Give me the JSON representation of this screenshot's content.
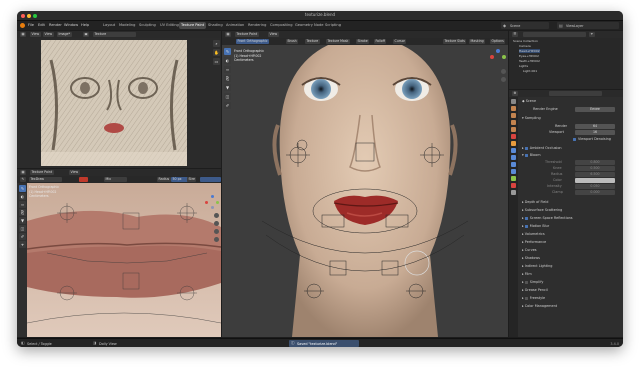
{
  "window": {
    "title": "texturize.blend"
  },
  "menu": [
    "File",
    "Edit",
    "Render",
    "Window",
    "Help"
  ],
  "workspaces": [
    {
      "label": "Layout",
      "active": false
    },
    {
      "label": "Modeling",
      "active": false
    },
    {
      "label": "Sculpting",
      "active": false
    },
    {
      "label": "UV Editing",
      "active": false
    },
    {
      "label": "Texture Paint",
      "active": true
    },
    {
      "label": "Shading",
      "active": false
    },
    {
      "label": "Animation",
      "active": false
    },
    {
      "label": "Rendering",
      "active": false
    },
    {
      "label": "Compositing",
      "active": false
    },
    {
      "label": "Geometry Node",
      "active": false
    },
    {
      "label": "Scripting",
      "active": false
    }
  ],
  "scene": {
    "label": "Scene",
    "view_layer": "ViewLayer"
  },
  "image_editor": {
    "header": [
      "View",
      "View",
      "Image*"
    ],
    "image_name": "Texture"
  },
  "texture_paint_editor": {
    "mode": "Texture Paint",
    "view": "View",
    "brush": "TexDraw",
    "blend": "Mix",
    "radius_label": "Radius",
    "radius": "50 px",
    "strength_label": "Stre",
    "overlay": [
      "Front Orthographic",
      "(1) Head+HP.002",
      "Centimeters"
    ]
  },
  "viewport": {
    "mode": "Texture Paint",
    "header": [
      "View",
      "Brush",
      "Texture",
      "Texture Mask",
      "Stroke",
      "Falloff",
      "Cursor"
    ],
    "paint_slot": "Texture Slots",
    "masking": "Masking",
    "options": "Options",
    "overlay": [
      "Front Orthographic",
      "(1) Head+HP.002",
      "Centimeters"
    ]
  },
  "outliner": {
    "search_placeholder": "",
    "rows": [
      "Scene Collection",
      "Camera",
      "Head+HP.002",
      "Eyes+HP.002",
      "Teeth+HP.002",
      "Lights",
      "Light.001"
    ]
  },
  "properties": {
    "title": "Scene",
    "render_engine_label": "Render Engine",
    "render_engine": "Eevee",
    "sampling": "Sampling",
    "render_label": "Render",
    "render_value": "64",
    "viewport_label": "Viewport",
    "viewport_value": "16",
    "viewport_denoising": "Viewport Denoising",
    "ambient_occlusion": "Ambient Occlusion",
    "bloom": "Bloom",
    "bloom_rows": [
      {
        "label": "Threshold",
        "value": "0.800"
      },
      {
        "label": "Knee",
        "value": "0.500"
      },
      {
        "label": "Radius",
        "value": "6.500"
      },
      {
        "label": "Color",
        "value": ""
      },
      {
        "label": "Intensity",
        "value": "0.050"
      },
      {
        "label": "Clamp",
        "value": "0.000"
      }
    ],
    "sections": [
      "Depth of Field",
      "Subsurface Scattering",
      "Screen Space Reflections",
      "Motion Blur",
      "Volumetrics",
      "Performance",
      "Curves",
      "Shadows",
      "Indirect Lighting",
      "Film",
      "Simplify",
      "Grease Pencil",
      "Freestyle",
      "Color Management"
    ]
  },
  "status_bar": {
    "left": "Select / Toggle",
    "middle": "Dolly View",
    "saved": "Saved \"texturize.blend\"",
    "version": "3.4.0"
  },
  "colors": {
    "accent": "#4772b3",
    "lip": "#a3302c",
    "skin": "#d8bda2",
    "selected_panel": "#3d5a8a"
  },
  "icons": [
    "apple-close",
    "apple-min",
    "apple-max",
    "blender-logo",
    "brush-icon",
    "fill-icon",
    "smear-icon",
    "clone-icon",
    "mask-icon",
    "scene-icon",
    "render-icon",
    "output-icon",
    "view-layer-icon",
    "world-icon",
    "object-icon",
    "modifier-icon",
    "material-icon"
  ]
}
